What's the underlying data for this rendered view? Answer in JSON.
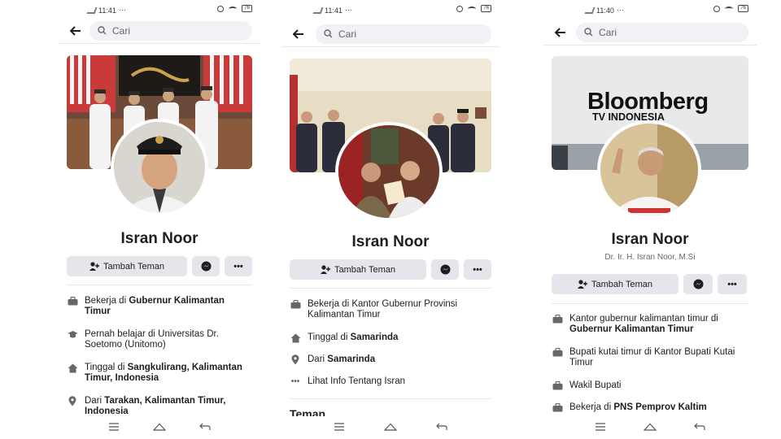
{
  "status": {
    "times": [
      "11:41",
      "11:41",
      "11:40"
    ],
    "battery": "76",
    "network": "4G"
  },
  "search": {
    "placeholder": "Cari"
  },
  "profiles": [
    {
      "name": "Isran Noor",
      "subtitle": "",
      "add_friend": "Tambah Teman",
      "info": [
        {
          "icon": "briefcase-icon",
          "pre": "Bekerja di ",
          "bold": "Gubernur Kalimantan Timur"
        },
        {
          "icon": "graduation-cap-icon",
          "pre": "Pernah belajar di Universitas Dr. Soetomo (Unitomo)",
          "bold": ""
        },
        {
          "icon": "home-icon",
          "pre": "Tinggal di ",
          "bold": "Sangkulirang, Kalimantan Timur, Indonesia"
        },
        {
          "icon": "location-pin-icon",
          "pre": "Dari ",
          "bold": "Tarakan, Kalimantan Timur, Indonesia"
        }
      ]
    },
    {
      "name": "Isran Noor",
      "subtitle": "",
      "add_friend": "Tambah Teman",
      "info": [
        {
          "icon": "briefcase-icon",
          "pre": "Bekerja di Kantor Gubernur Provinsi Kalimantan Timur",
          "bold": ""
        },
        {
          "icon": "home-icon",
          "pre": "Tinggal di ",
          "bold": "Samarinda"
        },
        {
          "icon": "location-pin-icon",
          "pre": "Dari ",
          "bold": "Samarinda"
        },
        {
          "icon": "more-dots-icon",
          "pre": "Lihat Info Tentang Isran",
          "bold": ""
        }
      ],
      "section": "Teman"
    },
    {
      "name": "Isran Noor",
      "subtitle": "Dr. Ir. H. Isran Noor, M.Si",
      "add_friend": "Tambah Teman",
      "cover_text": {
        "line1": "Bloomberg",
        "line2": "TV INDONESIA"
      },
      "info": [
        {
          "icon": "briefcase-icon",
          "pre": "Kantor gubernur kalimantan timur di ",
          "bold": "Gubernur Kalimantan Timur"
        },
        {
          "icon": "briefcase-icon",
          "pre": "Bupati kutai timur di Kantor Bupati Kutai Timur",
          "bold": ""
        },
        {
          "icon": "briefcase-icon",
          "pre": "Wakil Bupati",
          "bold": ""
        },
        {
          "icon": "briefcase-icon",
          "pre": "Bekerja di ",
          "bold": "PNS Pemprov Kaltim"
        }
      ]
    }
  ],
  "colors": {
    "button_bg": "#e4e6eb",
    "divider": "#e4e6eb",
    "text": "#1c1e21",
    "muted": "#65676b"
  }
}
